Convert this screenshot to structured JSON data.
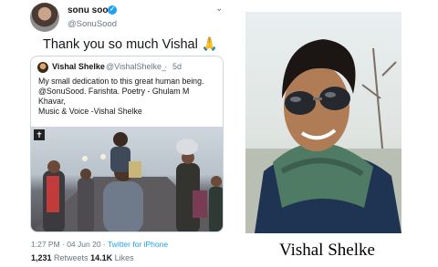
{
  "tweet": {
    "display_name": "sonu sood",
    "verified_icon": "verified-check-icon",
    "handle": "@SonuSood",
    "menu_icon": "chevron-down-icon",
    "text": "Thank you so much Vishal",
    "emoji": "🙏",
    "quoted": {
      "display_name": "Vishal Shelke",
      "handle": "@VishalShelke_",
      "separator": "·",
      "time": "5d",
      "body_lines": [
        "My small dedication to this great human being.",
        "@SonuSood. Farishta. Poetry - Ghulam M",
        "Khavar,",
        "Music & Voice -Vishal Shelke"
      ],
      "video_badge": "✝"
    },
    "timestamp": "1:27 PM · 04 Jun 20 · ",
    "source": "Twitter for iPhone",
    "retweets_count": "1,231",
    "retweets_label": " Retweets  ",
    "likes_count": "14.1K",
    "likes_label": " Likes"
  },
  "photo": {
    "caption": "Vishal Shelke"
  },
  "colors": {
    "link": "#1da1f2",
    "secondary_text": "#657786",
    "border": "#ccd6dd"
  }
}
